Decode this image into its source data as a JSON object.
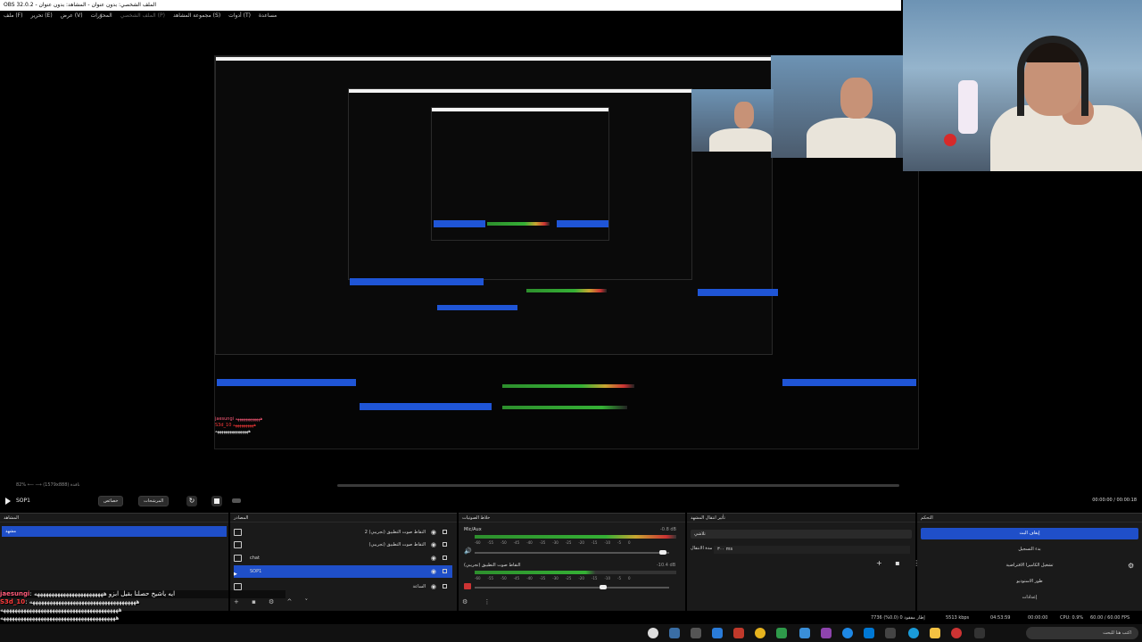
{
  "window": {
    "title": "OBS 32.0.2 - الملف الشخصي: بدون عنوان - المشاهد: بدون عنوان"
  },
  "menu": {
    "items": [
      "ملف (F)",
      "تحرير (E)",
      "عرض (V)",
      "المحوّرات",
      "الملف الشخصي (P)",
      "مجموعة المشاهد (S)",
      "أدوات (T)",
      "مساعدة"
    ]
  },
  "preview": {
    "zoom_text": "82% ⟵ ⟶ (1579x888) نافذة"
  },
  "controls": {
    "scene": "SOP1",
    "filters_label": "خصائص",
    "transitions_label": "المرشحات",
    "time": "00:00:00 / 00:00:18"
  },
  "docks": {
    "scenes": {
      "title": "المشاهد",
      "selected": "مشهد"
    },
    "sources": {
      "title": "المصادر",
      "rows": [
        {
          "label": "التقاط صوت التطبيق (تجريبي) 2"
        },
        {
          "label": "التقاط صوت التطبيق (تجريبي)"
        },
        {
          "label": "chat"
        },
        {
          "label": "SOP1",
          "selected": true
        },
        {
          "label": "الساعة"
        }
      ]
    },
    "mixer": {
      "title": "خلاط الصوتيات",
      "channels": [
        {
          "name": "Mic/Aux",
          "db": "-0.8 dB",
          "level": 0.8
        },
        {
          "name": "التقاط صوت التطبيق (تجريبي)",
          "db": "-10.4 dB",
          "level": 0.6
        }
      ],
      "ticks": [
        "-60",
        "-55",
        "-50",
        "-45",
        "-40",
        "-35",
        "-30",
        "-25",
        "-20",
        "-15",
        "-10",
        "-5",
        "0"
      ]
    },
    "transitions": {
      "title": "تأثير انتقال المشهد",
      "type": "تلاشي",
      "duration_label": "مدة الانتقال",
      "duration": "٣٠٠ ms"
    },
    "controls": {
      "title": "التحكم",
      "buttons": [
        "إيقاف البث",
        "بدء التسجيل",
        "تشغيل الكاميرا الافتراضية",
        "طور الاستوديو",
        "إعدادات"
      ]
    }
  },
  "chat": {
    "lines": [
      {
        "user": "jaesungi",
        "text": ": ايه ياشيخ حصلنا بقيل ابزو ههههههههههههههههههههههههه"
      },
      {
        "user": "S3d_10",
        "text": ": هههههههههههههههههههههههههههههههههههههه"
      },
      {
        "user": "",
        "text": "هههههههههههههههههههههههههههههههههههههههههه"
      },
      {
        "user": "",
        "text": "ههههههههههههههههههههههههههههههههههههههههه"
      }
    ]
  },
  "status": {
    "fps": "60.00 / 60.00 FPS",
    "cpu": "CPU: 0.9%",
    "rec": "00:00:00",
    "stream": "04:53:59",
    "kbps": "5513 kbps",
    "dropped": "إطار مفقود 0 (0.0%) 7736"
  },
  "taskbar": {
    "search": "اكتب هنا للبحث"
  }
}
